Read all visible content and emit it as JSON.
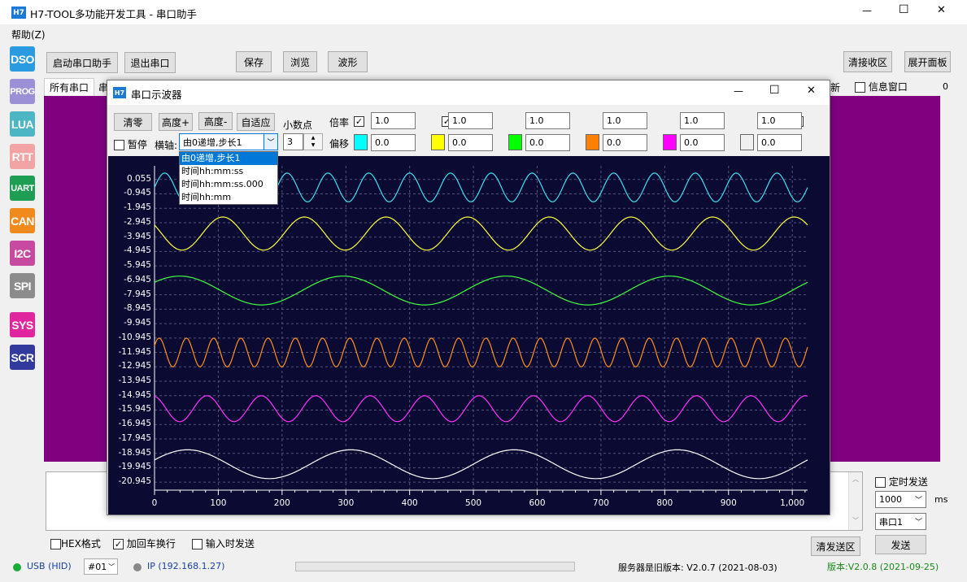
{
  "main_window": {
    "logo": "H7",
    "title": "H7-TOOL多功能开发工具 - 串口助手",
    "menu_help": "帮助(Z)",
    "controls": {
      "minimize": "—",
      "maximize": "☐",
      "close": "✕"
    }
  },
  "sidebar": [
    {
      "label": "DSO",
      "color": "#2a9be0"
    },
    {
      "label": "PROG",
      "color": "#9b8fd6"
    },
    {
      "label": "LUA",
      "color": "#4db6c4"
    },
    {
      "label": "RTT",
      "color": "#f2a3a3"
    },
    {
      "label": "UART",
      "color": "#1e9e52"
    },
    {
      "label": "CAN",
      "color": "#f08a1c"
    },
    {
      "label": "I2C",
      "color": "#c84aa0"
    },
    {
      "label": "SPI",
      "color": "#8c8c8c"
    },
    {
      "label": "SYS",
      "color": "#e0259e"
    },
    {
      "label": "SCR",
      "color": "#333a9e"
    }
  ],
  "toolbar": {
    "start_uart": "启动串口助手",
    "exit_uart": "退出串口",
    "save": "保存",
    "browse": "浏览",
    "waveform": "波形",
    "clear_recv": "清接收区",
    "expand_panel": "展开面板"
  },
  "tabs": {
    "all_ports": "所有串口",
    "partial": "串",
    "right_partial": "新",
    "info_window": "信息窗口",
    "count": "0"
  },
  "scope": {
    "logo": "H7",
    "title": "串口示波器",
    "clear": "清零",
    "height_plus": "高度+",
    "height_minus": "高度-",
    "adaptive": "自适应",
    "decimal_label": "小数点",
    "decimal_value": "3",
    "pause": "暂停",
    "axis_label": "横轴:",
    "axis_value": "由0递增,步长1",
    "axis_options": [
      "由0递增,步长1",
      "时间hh:mm:ss",
      "时间hh:mm:ss.000",
      "时间hh:mm"
    ],
    "scale_label": "倍率",
    "offset_label": "偏移",
    "channels": [
      {
        "scale": "1.0",
        "offset": "0.0",
        "color": "#00ffff"
      },
      {
        "scale": "1.0",
        "offset": "0.0",
        "color": "#ffff00"
      },
      {
        "scale": "1.0",
        "offset": "0.0",
        "color": "#00ff00"
      },
      {
        "scale": "1.0",
        "offset": "0.0",
        "color": "#ff8000"
      },
      {
        "scale": "1.0",
        "offset": "0.0",
        "color": "#ff00ff"
      },
      {
        "scale": "1.0",
        "offset": "0.0",
        "color": "#f0f0f0"
      }
    ]
  },
  "chart_data": {
    "type": "line",
    "xlim": [
      0,
      1024
    ],
    "ylim": [
      -21.5,
      1
    ],
    "x_ticks": [
      "0",
      "100",
      "200",
      "300",
      "400",
      "500",
      "600",
      "700",
      "800",
      "900",
      "1,000"
    ],
    "x_tick_values": [
      0,
      100,
      200,
      300,
      400,
      500,
      600,
      700,
      800,
      900,
      1000
    ],
    "y_ticks": [
      "0.055",
      "-0.945",
      "-1.945",
      "-2.945",
      "-3.945",
      "-4.945",
      "-5.945",
      "-6.945",
      "-7.945",
      "-8.945",
      "-9.945",
      "-10.945",
      "-11.945",
      "-12.945",
      "-13.945",
      "-14.945",
      "-15.945",
      "-16.945",
      "-17.945",
      "-18.945",
      "-19.945",
      "-20.945"
    ],
    "y_tick_values": [
      0.055,
      -0.945,
      -1.945,
      -2.945,
      -3.945,
      -4.945,
      -5.945,
      -6.945,
      -7.945,
      -8.945,
      -9.945,
      -10.945,
      -11.945,
      -12.945,
      -13.945,
      -14.945,
      -15.945,
      -16.945,
      -17.945,
      -18.945,
      -19.945,
      -20.945
    ],
    "grid": true,
    "series": [
      {
        "color": "#3fe0f0",
        "center": -0.5,
        "amplitude": 1.0,
        "period": 64,
        "phase": 0
      },
      {
        "color": "#ffff40",
        "center": -3.7,
        "amplitude": 1.15,
        "period": 128,
        "phase": 2.6
      },
      {
        "color": "#40ff40",
        "center": -7.65,
        "amplitude": 1.0,
        "period": 256,
        "phase": 0.6
      },
      {
        "color": "#ff9020",
        "center": -11.95,
        "amplitude": 1.0,
        "period": 42.7,
        "phase": 0.5
      },
      {
        "color": "#ff30ff",
        "center": -15.85,
        "amplitude": 0.9,
        "period": 85.3,
        "phase": 1.8
      },
      {
        "color": "#ffffff",
        "center": -19.7,
        "amplitude": 1.0,
        "period": 256,
        "phase": 0.3
      }
    ]
  },
  "bottom": {
    "hex_format": "HEX格式",
    "add_crlf": "加回车换行",
    "send_on_input": "输入时发送",
    "timed_send": "定时发送",
    "interval": "1000",
    "interval_unit": "ms",
    "port": "串口1",
    "clear_send": "清发送区",
    "send": "发送"
  },
  "status": {
    "usb": "USB (HID)",
    "device": "#01",
    "ip": "IP (192.168.1.27)",
    "server_version": "服务器是旧版本: V2.0.7 (2021-08-03)",
    "version": "版本:V2.0.8 (2021-09-25)"
  }
}
